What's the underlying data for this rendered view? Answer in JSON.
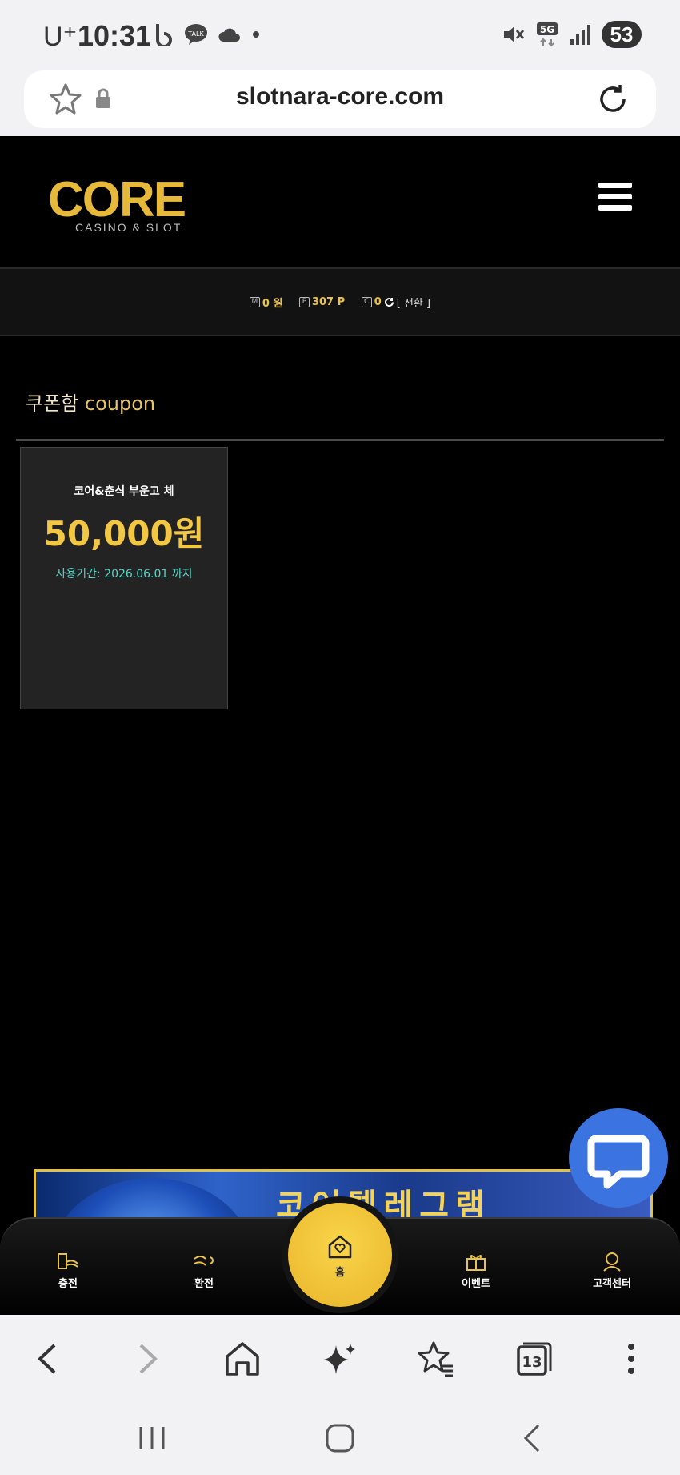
{
  "status_bar": {
    "carrier": "U⁺",
    "time": "10:31",
    "battery": "53",
    "network": "5G"
  },
  "browser": {
    "url": "slotnara-core.com",
    "tab_count": "13"
  },
  "site": {
    "logo_text": "CORE",
    "logo_subtitle": "CASINO & SLOT",
    "balances": {
      "money": "0 원",
      "points": "307 P",
      "comp": "0",
      "switch_label": "[ 전환 ]"
    }
  },
  "section": {
    "title_ko": "쿠폰함",
    "title_en": "coupon"
  },
  "coupons": [
    {
      "name": "코어&춘식 부운고 체",
      "amount": "50,000원",
      "expiry": "사용기간: 2026.06.01 까지"
    }
  ],
  "banner": {
    "text": "코어텔레그램"
  },
  "bottom_nav": {
    "items": [
      {
        "label": "충전",
        "icon": "deposit-icon"
      },
      {
        "label": "환전",
        "icon": "exchange-icon"
      },
      {
        "label": "홈",
        "icon": "home-heart-icon"
      },
      {
        "label": "이벤트",
        "icon": "gift-icon"
      },
      {
        "label": "고객센터",
        "icon": "support-icon"
      }
    ]
  },
  "colors": {
    "accent_gold": "#f2c744",
    "expiry_teal": "#56d6c8",
    "chat_blue": "#3b73e0"
  }
}
